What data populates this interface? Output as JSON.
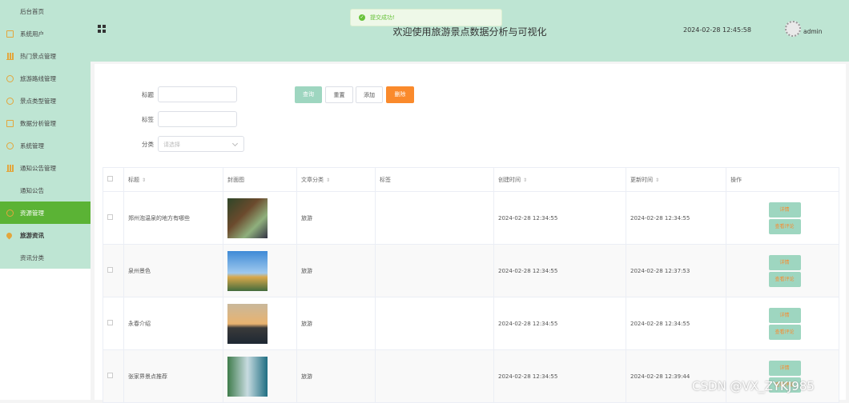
{
  "sidebar": {
    "items": [
      {
        "label": "后台首页",
        "icon": "none"
      },
      {
        "label": "系统用户",
        "icon": "document-icon"
      },
      {
        "label": "热门景点管理",
        "icon": "bar-chart-icon"
      },
      {
        "label": "旅游路线管理",
        "icon": "circle-icon"
      },
      {
        "label": "景点类型管理",
        "icon": "circle-icon"
      },
      {
        "label": "数据分析管理",
        "icon": "document-icon"
      },
      {
        "label": "系统管理",
        "icon": "circle-icon"
      },
      {
        "label": "通知公告管理",
        "icon": "bar-chart-icon"
      },
      {
        "label": "通知公告",
        "icon": "none"
      },
      {
        "label": "资源管理",
        "icon": "circle-icon"
      },
      {
        "label": "旅游资讯",
        "icon": "location-pin-icon"
      },
      {
        "label": "资讯分类",
        "icon": "none"
      }
    ]
  },
  "header": {
    "title": "欢迎使用旅游景点数据分析与可视化",
    "datetime": "2024-02-28 12:45:58",
    "username": "admin"
  },
  "toast": {
    "message": "提交成功!"
  },
  "filters": {
    "title_label": "标题",
    "tag_label": "标签",
    "category_label": "分类",
    "category_placeholder": "请选择"
  },
  "buttons": {
    "search": "查询",
    "reset": "重置",
    "add": "添加",
    "delete": "删除"
  },
  "table": {
    "headers": [
      "标题",
      "封面图",
      "文章分类",
      "标签",
      "创建时间",
      "更新时间",
      "操作"
    ],
    "rows": [
      {
        "title": "郑州泡温泉的地方有哪些",
        "category": "旅游",
        "tag": "",
        "created": "2024-02-28 12:34:55",
        "updated": "2024-02-28 12:34:55"
      },
      {
        "title": "泉州景色",
        "category": "旅游",
        "tag": "",
        "created": "2024-02-28 12:34:55",
        "updated": "2024-02-28 12:37:53"
      },
      {
        "title": "永春介绍",
        "category": "旅游",
        "tag": "",
        "created": "2024-02-28 12:34:55",
        "updated": "2024-02-28 12:34:55"
      },
      {
        "title": "张家界景点推荐",
        "category": "旅游",
        "tag": "",
        "created": "2024-02-28 12:34:55",
        "updated": "2024-02-28 12:39:44"
      }
    ],
    "action_detail": "详情",
    "action_comment": "查看评论"
  },
  "watermark": "CSDN @VX_ZYKJ985",
  "colors": {
    "menu_bg": "#bee5d3",
    "active": "#5bb335",
    "accent_orange": "#fa8a2c",
    "button_green": "#9ed6c0"
  }
}
